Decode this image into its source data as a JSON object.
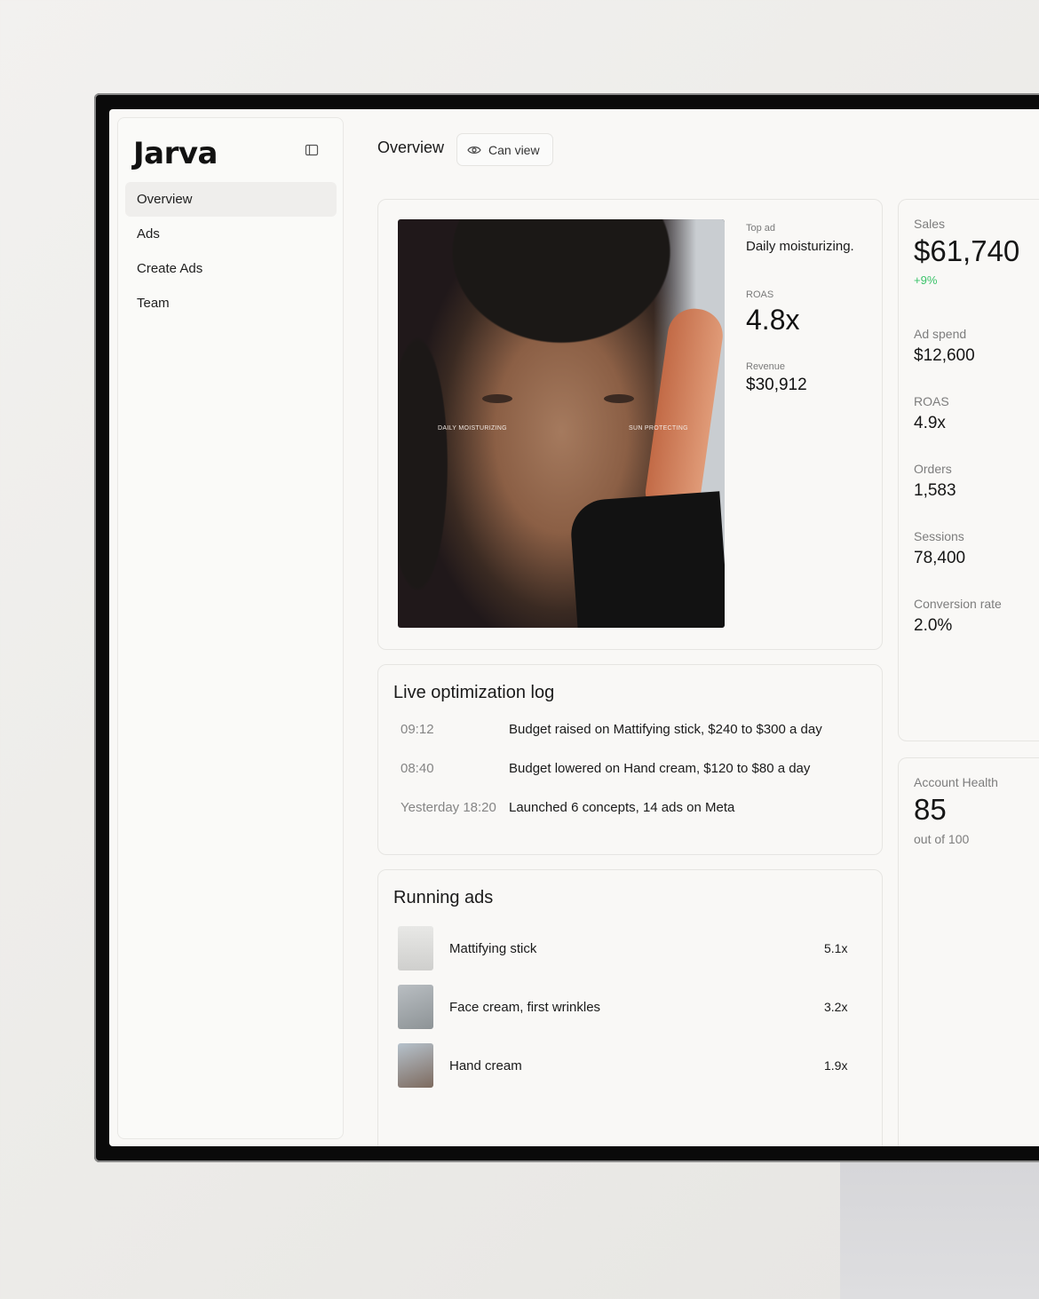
{
  "app": {
    "logo": "Jarva"
  },
  "sidebar": {
    "items": [
      {
        "label": "Overview",
        "active": true
      },
      {
        "label": "Ads",
        "active": false
      },
      {
        "label": "Create Ads",
        "active": false
      },
      {
        "label": "Team",
        "active": false
      }
    ]
  },
  "header": {
    "title": "Overview",
    "permission_label": "Can view"
  },
  "top_ad": {
    "label": "Top ad",
    "name": "Daily moisturizing.",
    "roas_label": "ROAS",
    "roas_value": "4.8x",
    "revenue_label": "Revenue",
    "revenue_value": "$30,912",
    "image_text_left": "DAILY MOISTURIZING",
    "image_text_right": "SUN PROTECTING"
  },
  "log": {
    "title": "Live optimization log",
    "entries": [
      {
        "time": "09:12",
        "text": "Budget raised on Mattifying stick, $240 to $300 a day"
      },
      {
        "time": "08:40",
        "text": "Budget lowered on Hand cream, $120 to $80 a day"
      },
      {
        "time": "Yesterday 18:20",
        "text": "Launched 6 concepts, 14 ads on Meta"
      }
    ]
  },
  "running_ads": {
    "title": "Running ads",
    "items": [
      {
        "name": "Mattifying stick",
        "roas": "5.1x"
      },
      {
        "name": "Face cream, first wrinkles",
        "roas": "3.2x"
      },
      {
        "name": "Hand cream",
        "roas": "1.9x"
      }
    ]
  },
  "stats": {
    "sales_label": "Sales",
    "sales_value": "$61,740",
    "sales_delta": "+9%",
    "ad_spend_label": "Ad spend",
    "ad_spend_value": "$12,600",
    "roas_label": "ROAS",
    "roas_value": "4.9x",
    "orders_label": "Orders",
    "orders_value": "1,583",
    "sessions_label": "Sessions",
    "sessions_value": "78,400",
    "conversion_label": "Conversion rate",
    "conversion_value": "2.0%"
  },
  "health": {
    "label": "Account Health",
    "value": "85",
    "scale": "out of 100"
  },
  "colors": {
    "positive": "#3cc36a",
    "active_nav": "#efeeec",
    "bezel": "#0a0a0a"
  }
}
